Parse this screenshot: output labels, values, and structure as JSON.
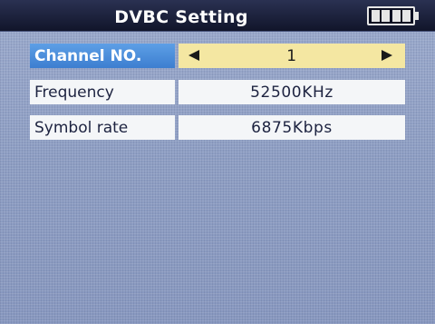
{
  "header": {
    "title": "DVBC Setting",
    "battery_icon": "battery-full-icon",
    "battery_level": 1.0
  },
  "rows": [
    {
      "label": "Channel NO.",
      "value": "1",
      "left_icon": "arrow-left-icon",
      "right_icon": "arrow-right-icon",
      "selected": true
    },
    {
      "label": "Frequency",
      "value": "52500KHz"
    },
    {
      "label": "Symbol rate",
      "value": "6875Kbps"
    }
  ],
  "colors": {
    "background": "#8f9fc4",
    "title_bar": "#1b2038",
    "selected_label": "#4a8cdc",
    "selected_value": "#f4e7a2",
    "field_background": "#f4f6f8",
    "text_dark": "#1d2340"
  }
}
